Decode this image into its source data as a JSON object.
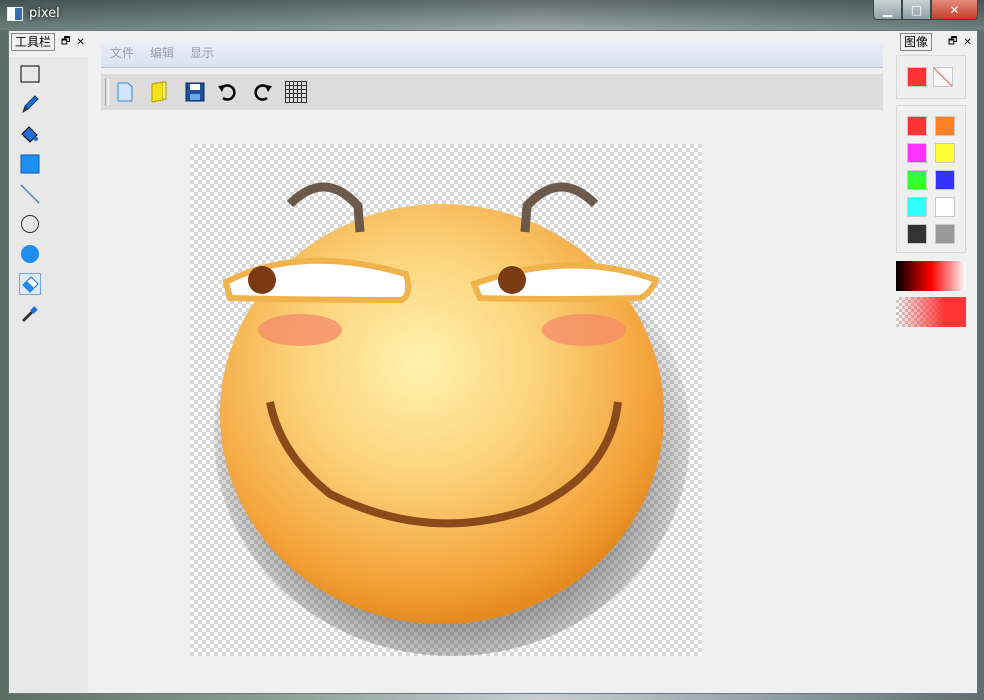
{
  "window": {
    "title": "pixel"
  },
  "left_dock": {
    "title": "工具栏",
    "float_icon": "restore-icon",
    "close_icon": "close-icon"
  },
  "right_dock": {
    "title": "图像",
    "float_icon": "restore-icon",
    "close_icon": "close-icon"
  },
  "menu": {
    "items": [
      "文件",
      "编辑",
      "显示"
    ]
  },
  "tools": [
    "rectangle-select-icon",
    "pencil-icon",
    "fill-bucket-icon",
    "filled-rectangle-icon",
    "line-icon",
    "ellipse-icon",
    "filled-ellipse-icon",
    "eraser-icon",
    "color-picker-icon"
  ],
  "toolbar": [
    "new-file-icon",
    "open-file-icon",
    "save-icon",
    "undo-icon",
    "redo-icon",
    "grid-icon"
  ],
  "colors": {
    "primary": "#ff3333",
    "secondary": "transparent",
    "palette": [
      "#ff3333",
      "#ff7f27",
      "#ff33ff",
      "#ffff33",
      "#33ff33",
      "#3333ff",
      "#33ffff",
      "#ffffff",
      "#333333",
      "#999999"
    ]
  }
}
